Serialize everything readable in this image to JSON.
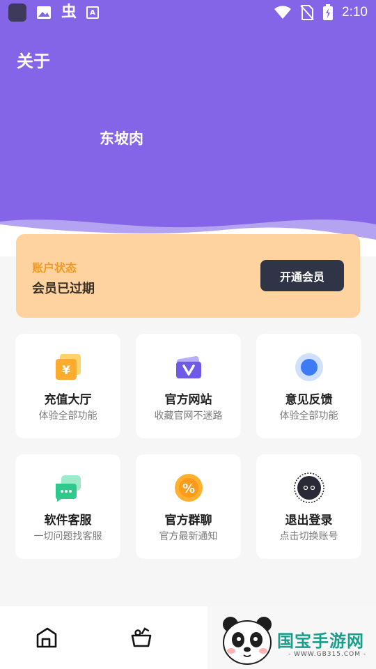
{
  "status_bar": {
    "time": "2:10",
    "left_icons": [
      "app-icon",
      "image-icon",
      "bug-glyph-icon",
      "font-a-icon"
    ],
    "right_icons": [
      "wifi-icon",
      "no-sim-icon",
      "battery-charging-icon"
    ]
  },
  "header": {
    "title": "关于",
    "username": "东坡肉",
    "color": "#8465e8"
  },
  "member_card": {
    "label": "账户状态",
    "status": "会员已过期",
    "button_label": "开通会员"
  },
  "tiles": [
    {
      "title": "充值大厅",
      "subtitle": "体验全部功能",
      "icon": "yuan-card-icon"
    },
    {
      "title": "官方网站",
      "subtitle": "收藏官网不迷路",
      "icon": "vip-card-icon"
    },
    {
      "title": "意见反馈",
      "subtitle": "体验全部功能",
      "icon": "feedback-circle-icon"
    },
    {
      "title": "软件客服",
      "subtitle": "一切问题找客服",
      "icon": "chat-bubbles-icon"
    },
    {
      "title": "官方群聊",
      "subtitle": "官方最新通知",
      "icon": "percent-badge-icon"
    },
    {
      "title": "退出登录",
      "subtitle": "点击切换账号",
      "icon": "logout-avatar-icon"
    }
  ],
  "bottom_nav": [
    {
      "icon": "home-icon"
    },
    {
      "icon": "fruit-basket-icon"
    }
  ],
  "watermark": {
    "text": "国宝手游网",
    "url": "- WWW.GB315.COM -"
  }
}
